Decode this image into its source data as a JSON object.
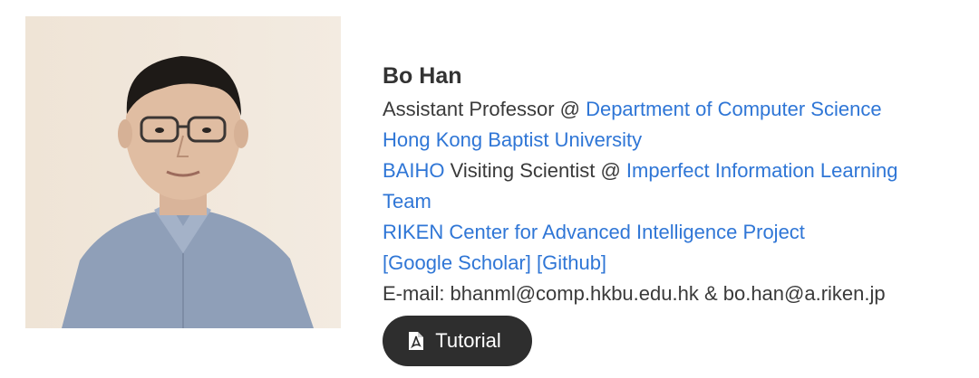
{
  "profile": {
    "name": "Bo Han",
    "position_prefix": "Assistant Professor @ ",
    "department_link": "Department of Computer Science",
    "university_link": "Hong Kong Baptist University",
    "baiho_link": "BAIHO",
    "visiting_text": " Visiting Scientist @ ",
    "team_link_part1": "Imperfect Information Learning",
    "team_link_part2": "Team",
    "riken_link": "RIKEN Center for Advanced Intelligence Project",
    "scholar_link": "[Google Scholar]",
    "github_link": "[Github]",
    "email": "E-mail: bhanml@comp.hkbu.edu.hk & bo.han@a.riken.jp"
  },
  "tutorial_button": {
    "label": "Tutorial",
    "icon": "pdf-file-icon"
  },
  "colors": {
    "link": "#2f76d6",
    "text": "#3a3a3a",
    "button_bg": "#2e2e2e"
  }
}
